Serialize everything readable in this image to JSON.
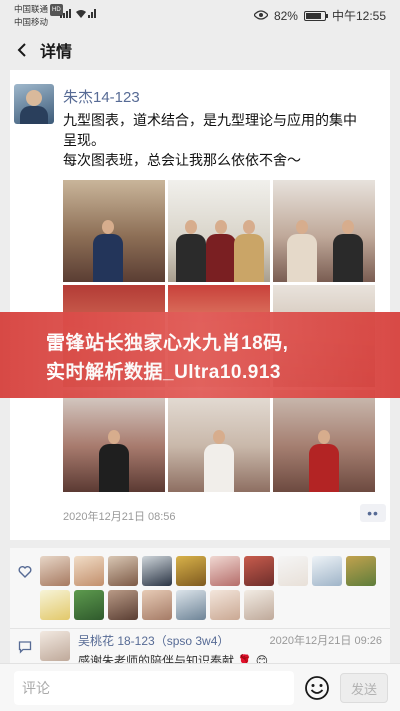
{
  "status_bar": {
    "carrier_1": "中国联通",
    "carrier_1_tag": "HD",
    "carrier_2": "中国移动",
    "battery": "82%",
    "battery_level": 0.82,
    "time": "中午12:55",
    "icons": [
      "signal-icon",
      "wifi-icon",
      "eye-icon",
      "battery-icon"
    ]
  },
  "header": {
    "title": "详情",
    "back_icon": "chevron-left-icon"
  },
  "post": {
    "author": "朱杰14-123",
    "text_line_1": "九型图表，道术结合，是九型理论与应用的集中",
    "text_line_2": "呈现。",
    "text_line_3": "每次图表班，总会让我那么依依不舍～",
    "photo_count": 9,
    "timestamp": "2020年12月21日 08:56",
    "more_label": "••"
  },
  "banner": {
    "line_1": "雷锋站长独家心水九肖18码,",
    "line_2": "实时解析数据_Ultra10.913",
    "background_color": "#d7433f"
  },
  "likes": {
    "icon": "heart-icon",
    "count": 17
  },
  "comment": {
    "icon": "comment-icon",
    "author": "吴桃花 18-123（spso 3w4）",
    "time": "2020年12月21日 09:26",
    "text": "感谢朱老师的陪伴与知识奉献 🌹 😊"
  },
  "input_bar": {
    "placeholder": "评论",
    "emoji_icon": "smiley-icon",
    "send_label": "发送"
  },
  "colors": {
    "link_blue": "#576b95",
    "page_bg": "#ededed"
  }
}
